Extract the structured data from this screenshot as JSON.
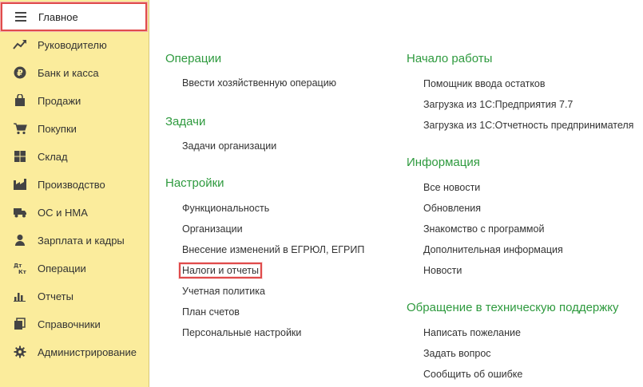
{
  "sidebar": {
    "items": [
      {
        "label": "Главное",
        "icon": "menu-icon"
      },
      {
        "label": "Руководителю",
        "icon": "trend-icon"
      },
      {
        "label": "Банк и касса",
        "icon": "ruble-icon"
      },
      {
        "label": "Продажи",
        "icon": "bag-icon"
      },
      {
        "label": "Покупки",
        "icon": "cart-icon"
      },
      {
        "label": "Склад",
        "icon": "warehouse-icon"
      },
      {
        "label": "Производство",
        "icon": "factory-icon"
      },
      {
        "label": "ОС и НМА",
        "icon": "truck-icon"
      },
      {
        "label": "Зарплата и кадры",
        "icon": "person-icon"
      },
      {
        "label": "Операции",
        "icon": "dt-kt-icon"
      },
      {
        "label": "Отчеты",
        "icon": "bar-chart-icon"
      },
      {
        "label": "Справочники",
        "icon": "books-icon"
      },
      {
        "label": "Администрирование",
        "icon": "gear-icon"
      }
    ]
  },
  "left": {
    "operations": {
      "title": "Операции",
      "links": [
        "Ввести хозяйственную операцию"
      ]
    },
    "tasks": {
      "title": "Задачи",
      "links": [
        "Задачи организации"
      ]
    },
    "settings": {
      "title": "Настройки",
      "links": [
        "Функциональность",
        "Организации",
        "Внесение изменений в ЕГРЮЛ, ЕГРИП",
        "Налоги и отчеты",
        "Учетная политика",
        "План счетов",
        "Персональные настройки"
      ]
    }
  },
  "right": {
    "start": {
      "title": "Начало работы",
      "links": [
        "Помощник ввода остатков",
        "Загрузка из 1С:Предприятия 7.7",
        "Загрузка из 1С:Отчетность предпринимателя"
      ]
    },
    "info": {
      "title": "Информация",
      "links": [
        "Все новости",
        "Обновления",
        "Знакомство с программой",
        "Дополнительная информация",
        "Новости"
      ]
    },
    "support": {
      "title": "Обращение в техническую поддержку",
      "links": [
        "Написать пожелание",
        "Задать вопрос",
        "Сообщить об ошибке"
      ]
    }
  },
  "colors": {
    "sidebar_bg": "#fbec9c",
    "section_title": "#2e9a3e",
    "highlight": "#e04c4c"
  }
}
